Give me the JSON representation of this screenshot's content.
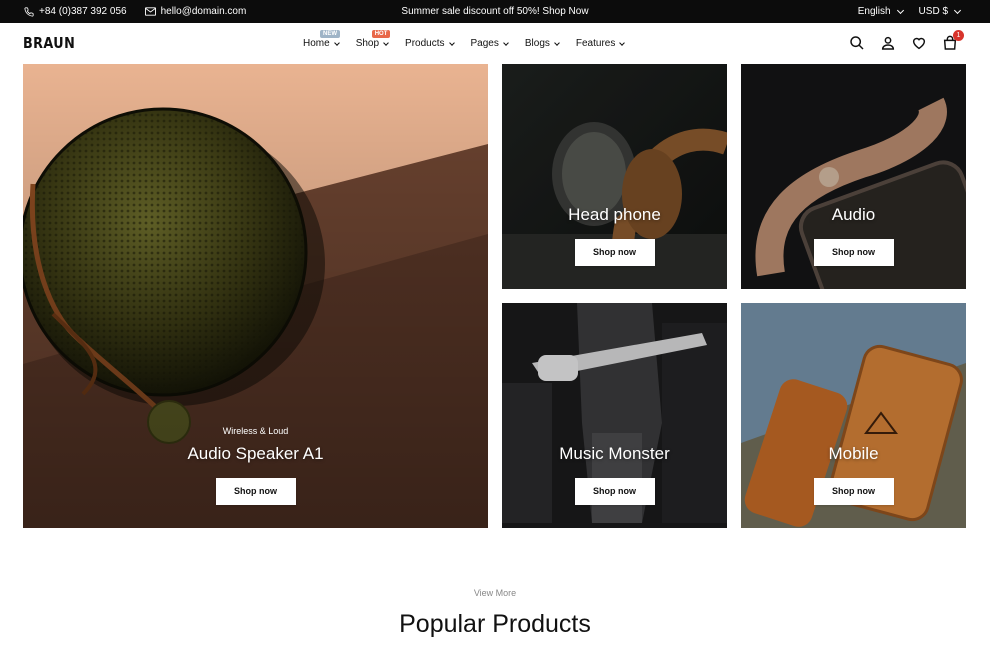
{
  "topbar": {
    "phone": "+84 (0)387 392 056",
    "email": "hello@domain.com",
    "promo": "Summer sale discount off 50%! Shop Now",
    "language": "English",
    "currency": "USD $"
  },
  "header": {
    "logo": "BRAUN",
    "nav": [
      {
        "label": "Home",
        "badge": "NEW",
        "badge_color": "#9fb4c7"
      },
      {
        "label": "Shop",
        "badge": "HOT",
        "badge_color": "#e8684a"
      },
      {
        "label": "Products"
      },
      {
        "label": "Pages"
      },
      {
        "label": "Blogs"
      },
      {
        "label": "Features"
      }
    ],
    "cart_count": "1",
    "icons": [
      "search-icon",
      "user-icon",
      "heart-icon",
      "cart-icon"
    ]
  },
  "banners": {
    "main": {
      "subtitle": "Wireless & Loud",
      "title": "Audio Speaker A1",
      "button": "Shop now"
    },
    "headphone": {
      "title": "Head phone",
      "button": "Shop now"
    },
    "audio": {
      "title": "Audio",
      "button": "Shop now"
    },
    "music": {
      "title": "Music Monster",
      "button": "Shop now"
    },
    "mobile": {
      "title": "Mobile",
      "button": "Shop now"
    }
  },
  "section": {
    "view_more": "View More",
    "title": "Popular Products"
  },
  "colors": {
    "topbar_bg": "#0c0c0c",
    "badge_hot": "#e8684a",
    "badge_new": "#9fb4c7",
    "cart_badge": "#d8342c"
  }
}
